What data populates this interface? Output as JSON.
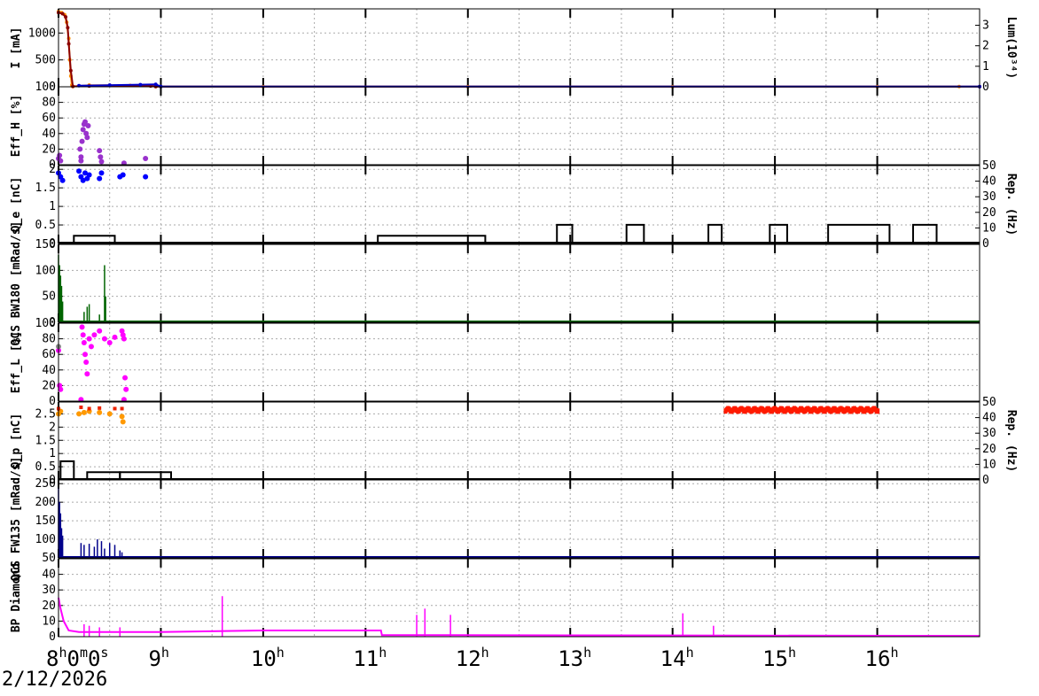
{
  "date": "2/12/2026",
  "chart_data": {
    "type": "line",
    "x_axis": {
      "unit": "hour",
      "range": [
        8.0,
        17.0
      ],
      "ticks": [
        {
          "value": 8,
          "label": "8",
          "sup": "h",
          "suffix": "0",
          "suffix_sup": "m",
          "suffix2": "0",
          "suffix2_sup": "s"
        },
        {
          "value": 9,
          "label": "9",
          "sup": "h"
        },
        {
          "value": 10,
          "label": "10",
          "sup": "h"
        },
        {
          "value": 11,
          "label": "11",
          "sup": "h"
        },
        {
          "value": 12,
          "label": "12",
          "sup": "h"
        },
        {
          "value": 13,
          "label": "13",
          "sup": "h"
        },
        {
          "value": 14,
          "label": "14",
          "sup": "h"
        },
        {
          "value": 15,
          "label": "15",
          "sup": "h"
        },
        {
          "value": 16,
          "label": "16",
          "sup": "h"
        }
      ]
    },
    "panels": [
      {
        "id": "current",
        "ylabel": "I [mA]",
        "ylim": [
          0,
          1450
        ],
        "yticks": [
          0,
          500,
          1000
        ],
        "right_ylabel": "Lum(10³⁴)",
        "right_ylim": [
          0,
          3.8
        ],
        "right_yticks": [
          0,
          1,
          2,
          3
        ],
        "series": [
          {
            "color": "#ff8c00",
            "points": [
              [
                8.0,
                1400
              ],
              [
                8.03,
                1380
              ],
              [
                8.06,
                1340
              ],
              [
                8.08,
                1200
              ],
              [
                8.1,
                900
              ],
              [
                8.11,
                500
              ],
              [
                8.12,
                200
              ],
              [
                8.13,
                30
              ],
              [
                8.14,
                5
              ],
              [
                8.3,
                30
              ],
              [
                8.5,
                28
              ],
              [
                8.7,
                25
              ],
              [
                8.9,
                20
              ],
              [
                8.95,
                5
              ],
              [
                10,
                3
              ],
              [
                12,
                3
              ],
              [
                14,
                3
              ],
              [
                16,
                3
              ],
              [
                16.8,
                4
              ]
            ]
          },
          {
            "color": "#8b0000",
            "points": [
              [
                8.0,
                1380
              ],
              [
                8.04,
                1360
              ],
              [
                8.07,
                1300
              ],
              [
                8.09,
                1100
              ],
              [
                8.1,
                800
              ],
              [
                8.12,
                300
              ],
              [
                8.14,
                8
              ],
              [
                8.3,
                15
              ],
              [
                8.9,
                15
              ],
              [
                8.95,
                4
              ],
              [
                17,
                3
              ]
            ]
          },
          {
            "color": "#0000cd",
            "points": [
              [
                8.2,
                20
              ],
              [
                8.5,
                30
              ],
              [
                8.8,
                40
              ],
              [
                8.95,
                45
              ],
              [
                9.0,
                5
              ],
              [
                17,
                4
              ]
            ]
          }
        ]
      },
      {
        "id": "eff_h",
        "ylabel": "Eff_H [%]",
        "ylim": [
          0,
          100
        ],
        "yticks": [
          0,
          20,
          40,
          60,
          80,
          100
        ],
        "scatter_color": "#9932cc",
        "scatter": [
          [
            8.0,
            8
          ],
          [
            8.01,
            12
          ],
          [
            8.02,
            5
          ],
          [
            8.22,
            10
          ],
          [
            8.23,
            30
          ],
          [
            8.24,
            45
          ],
          [
            8.25,
            52
          ],
          [
            8.26,
            55
          ],
          [
            8.27,
            40
          ],
          [
            8.28,
            35
          ],
          [
            8.29,
            50
          ],
          [
            8.21,
            20
          ],
          [
            8.22,
            5
          ],
          [
            8.4,
            18
          ],
          [
            8.41,
            10
          ],
          [
            8.42,
            4
          ],
          [
            8.64,
            2
          ],
          [
            8.85,
            8
          ]
        ]
      },
      {
        "id": "qe",
        "ylabel": "Q_e [nC]",
        "ylim": [
          0,
          2.1
        ],
        "yticks": [
          0,
          0.5,
          1,
          1.5,
          2
        ],
        "right_ylabel": "Rep. (Hz)",
        "right_ylim": [
          0,
          50
        ],
        "right_yticks": [
          0,
          10,
          20,
          30,
          40,
          50
        ],
        "scatter_color": "#0000ff",
        "scatter": [
          [
            8.0,
            1.9
          ],
          [
            8.02,
            1.8
          ],
          [
            8.04,
            1.7
          ],
          [
            8.2,
            1.95
          ],
          [
            8.22,
            1.8
          ],
          [
            8.24,
            1.7
          ],
          [
            8.26,
            1.9
          ],
          [
            8.28,
            1.75
          ],
          [
            8.3,
            1.85
          ],
          [
            8.4,
            1.75
          ],
          [
            8.42,
            1.9
          ],
          [
            8.6,
            1.8
          ],
          [
            8.63,
            1.85
          ],
          [
            8.85,
            1.8
          ]
        ],
        "rep_segments": [
          [
            8.15,
            8.55,
            5
          ],
          [
            11.12,
            12.17,
            5
          ],
          [
            12.87,
            13.02,
            12
          ],
          [
            13.55,
            13.72,
            12
          ],
          [
            14.35,
            14.48,
            12
          ],
          [
            14.95,
            15.12,
            12
          ],
          [
            15.52,
            16.12,
            12
          ],
          [
            16.35,
            16.58,
            12
          ]
        ]
      },
      {
        "id": "qcs_bw180",
        "ylabel": "QCS BW180 [mRad/s]",
        "ylim": [
          0,
          150
        ],
        "yticks": [
          0,
          50,
          100,
          150
        ],
        "bar_color": "#006400",
        "spikes": [
          [
            8.0,
            130
          ],
          [
            8.01,
            110
          ],
          [
            8.02,
            90
          ],
          [
            8.03,
            70
          ],
          [
            8.04,
            40
          ],
          [
            8.25,
            20
          ],
          [
            8.28,
            30
          ],
          [
            8.3,
            35
          ],
          [
            8.4,
            15
          ],
          [
            8.45,
            110
          ],
          [
            8.46,
            50
          ]
        ]
      },
      {
        "id": "eff_l",
        "ylabel": "Eff_L [%]",
        "ylim": [
          0,
          100
        ],
        "yticks": [
          0,
          20,
          40,
          60,
          80,
          100
        ],
        "scatter_color": "#ff00ff",
        "scatter": [
          [
            8.0,
            65
          ],
          [
            8.01,
            20
          ],
          [
            8.02,
            15
          ],
          [
            8.23,
            95
          ],
          [
            8.24,
            85
          ],
          [
            8.25,
            75
          ],
          [
            8.26,
            60
          ],
          [
            8.27,
            50
          ],
          [
            8.28,
            35
          ],
          [
            8.3,
            80
          ],
          [
            8.32,
            70
          ],
          [
            8.35,
            85
          ],
          [
            8.4,
            90
          ],
          [
            8.45,
            80
          ],
          [
            8.5,
            75
          ],
          [
            8.55,
            82
          ],
          [
            8.62,
            90
          ],
          [
            8.63,
            85
          ],
          [
            8.64,
            80
          ],
          [
            8.65,
            30
          ],
          [
            8.66,
            15
          ],
          [
            8.22,
            2
          ],
          [
            8.64,
            2
          ]
        ],
        "gray_point": [
          8.0,
          70
        ]
      },
      {
        "id": "qp",
        "ylabel": "Q_p [nC]",
        "ylim": [
          0,
          2.95
        ],
        "yticks": [
          0,
          0.5,
          1,
          1.5,
          2,
          2.5
        ],
        "right_ylabel": "Rep. (Hz)",
        "right_ylim": [
          0,
          50
        ],
        "right_yticks": [
          0,
          10,
          20,
          30,
          40,
          50
        ],
        "scatter_orange": [
          [
            8.0,
            2.5
          ],
          [
            8.02,
            2.6
          ],
          [
            8.2,
            2.5
          ],
          [
            8.25,
            2.55
          ],
          [
            8.3,
            2.6
          ],
          [
            8.4,
            2.55
          ],
          [
            8.5,
            2.5
          ],
          [
            8.62,
            2.4
          ],
          [
            8.63,
            2.2
          ]
        ],
        "scatter_red": [
          [
            8.0,
            2.7
          ],
          [
            8.22,
            2.75
          ],
          [
            8.3,
            2.7
          ],
          [
            8.4,
            2.72
          ],
          [
            8.55,
            2.7
          ],
          [
            8.62,
            2.7
          ]
        ],
        "red_band": [
          14.5,
          16.0,
          2.65
        ],
        "rep_segments": [
          [
            8.02,
            8.15,
            12
          ],
          [
            8.28,
            8.6,
            5
          ],
          [
            8.6,
            9.1,
            5
          ]
        ]
      },
      {
        "id": "qcs_fw135",
        "ylabel": "QCS FW135 [mRad/s]",
        "ylim": [
          50,
          260
        ],
        "yticks": [
          50,
          100,
          150,
          200,
          250
        ],
        "bar_color": "#00008b",
        "spikes": [
          [
            8.0,
            240
          ],
          [
            8.01,
            200
          ],
          [
            8.02,
            170
          ],
          [
            8.03,
            130
          ],
          [
            8.04,
            110
          ],
          [
            8.22,
            90
          ],
          [
            8.25,
            85
          ],
          [
            8.3,
            88
          ],
          [
            8.35,
            80
          ],
          [
            8.38,
            100
          ],
          [
            8.42,
            95
          ],
          [
            8.45,
            75
          ],
          [
            8.5,
            90
          ],
          [
            8.55,
            85
          ],
          [
            8.6,
            70
          ],
          [
            8.62,
            65
          ]
        ]
      },
      {
        "id": "bp_diamond",
        "ylabel": "BP Diamond",
        "ylim": [
          0,
          50
        ],
        "yticks": [
          0,
          10,
          20,
          30,
          40
        ],
        "line_color": "#ff00ff",
        "baseline": [
          [
            8.0,
            25
          ],
          [
            8.02,
            18
          ],
          [
            8.05,
            10
          ],
          [
            8.1,
            4
          ],
          [
            8.2,
            3
          ],
          [
            9.0,
            3
          ],
          [
            10.0,
            4
          ],
          [
            11.0,
            4
          ],
          [
            11.15,
            4
          ],
          [
            11.16,
            1
          ],
          [
            17,
            0.5
          ]
        ],
        "spikes": [
          [
            8.25,
            8
          ],
          [
            8.3,
            7
          ],
          [
            8.4,
            6
          ],
          [
            8.6,
            6
          ],
          [
            9.6,
            26
          ],
          [
            11.5,
            14
          ],
          [
            11.58,
            18
          ],
          [
            11.83,
            14
          ],
          [
            14.1,
            15
          ],
          [
            14.4,
            7
          ]
        ]
      }
    ]
  }
}
